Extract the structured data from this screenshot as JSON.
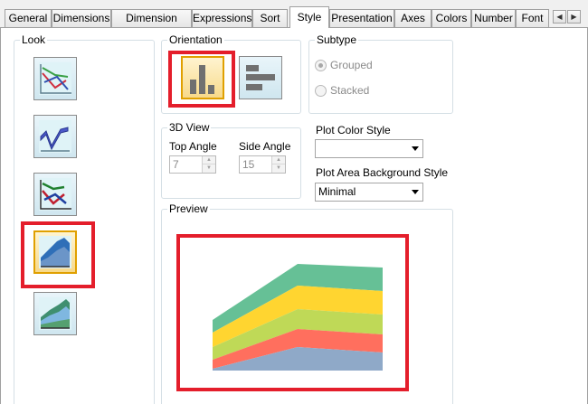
{
  "tabs": [
    {
      "label": "General"
    },
    {
      "label": "Dimensions"
    },
    {
      "label": "Dimension Limits"
    },
    {
      "label": "Expressions"
    },
    {
      "label": "Sort"
    },
    {
      "label": "Style",
      "active": true
    },
    {
      "label": "Presentation"
    },
    {
      "label": "Axes"
    },
    {
      "label": "Colors"
    },
    {
      "label": "Number"
    },
    {
      "label": "Font"
    }
  ],
  "tab_scroll": {
    "left": "◀",
    "right": "▶"
  },
  "look": {
    "title": "Look"
  },
  "orientation": {
    "title": "Orientation"
  },
  "subtype": {
    "title": "Subtype",
    "options": [
      {
        "label": "Grouped",
        "checked": true
      },
      {
        "label": "Stacked",
        "checked": false
      }
    ]
  },
  "view3d": {
    "title": "3D View",
    "top_angle_label": "Top Angle",
    "top_angle_value": "7",
    "side_angle_label": "Side Angle",
    "side_angle_value": "15"
  },
  "plot_color_style": {
    "label": "Plot Color Style",
    "value": ""
  },
  "plot_area_bg": {
    "label": "Plot Area Background Style",
    "value": "Minimal"
  },
  "preview": {
    "title": "Preview"
  },
  "preview_colors": {
    "top": "#66c096",
    "second": "#ffd530",
    "third": "#bfd957",
    "fourth": "#ff6f5e",
    "bottom": "#8fa9c8"
  },
  "highlight_color": "#e41e2b"
}
